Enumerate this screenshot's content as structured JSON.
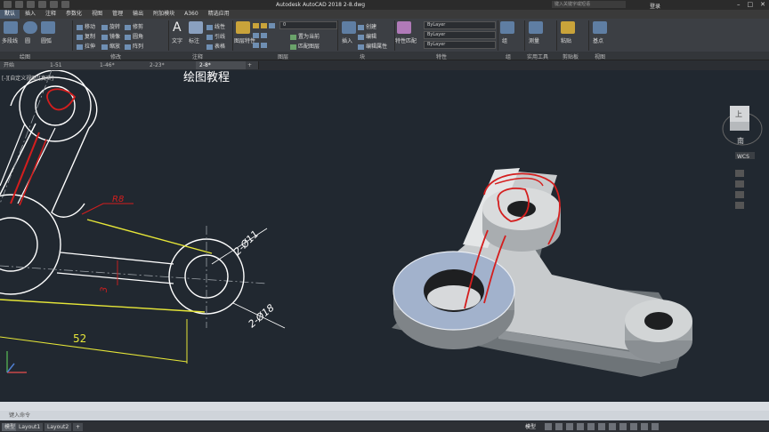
{
  "window": {
    "title": "Autodesk AutoCAD 2018    2-8.dwg",
    "search_placeholder": "键入关键字或短语",
    "user": "登录"
  },
  "menu": [
    "默认",
    "插入",
    "注释",
    "参数化",
    "视图",
    "管理",
    "输出",
    "附加模块",
    "A360",
    "精选应用"
  ],
  "ribbon": {
    "draw": [
      "多段线",
      "圆",
      "圆弧"
    ],
    "modify": [
      "移动",
      "旋转",
      "修剪",
      "复制",
      "镜像",
      "圆角",
      "拉伸",
      "缩放",
      "阵列"
    ],
    "annotation": [
      "文字",
      "标注",
      "线性",
      "引线",
      "表格"
    ],
    "layers": [
      "图层特性",
      "置为当前",
      "匹配图层"
    ],
    "layer_value": "0",
    "block": [
      "插入",
      "创建",
      "编辑",
      "编辑属性"
    ],
    "properties": {
      "label": "特性匹配",
      "color": "ByLayer",
      "linetype": "ByLayer",
      "lineweight": "ByLayer"
    },
    "groups": [
      "组"
    ],
    "utilities": [
      "测量"
    ],
    "clipboard": [
      "粘贴"
    ],
    "view": [
      "基点"
    ]
  },
  "panel_names": [
    "绘图",
    "修改",
    "注释",
    "图层",
    "块",
    "特性",
    "组",
    "实用工具",
    "剪贴板",
    "视图"
  ],
  "file_tabs": [
    "开始",
    "1-51",
    "1-46*",
    "2-23*",
    "2-8*"
  ],
  "view_label": "[-][自定义视图][真实]",
  "drawing": {
    "heading": "绘图教程",
    "dims": {
      "r8": "R8",
      "d11": "2-Ø11",
      "d18": "2-Ø18",
      "len52": "52",
      "three": "3"
    }
  },
  "viewcube": {
    "top": "上",
    "south": "南",
    "wcs": "WCS"
  },
  "command": {
    "placeholder": "键入命令"
  },
  "layouts": [
    "模型",
    "Layout1",
    "Layout2"
  ],
  "status": {
    "mode": "模型"
  },
  "colors": {
    "canvas": "#212830",
    "sketch_red": "#d41e1e",
    "yellow": "#e6e638",
    "face_blue": "#a2b2cc"
  }
}
